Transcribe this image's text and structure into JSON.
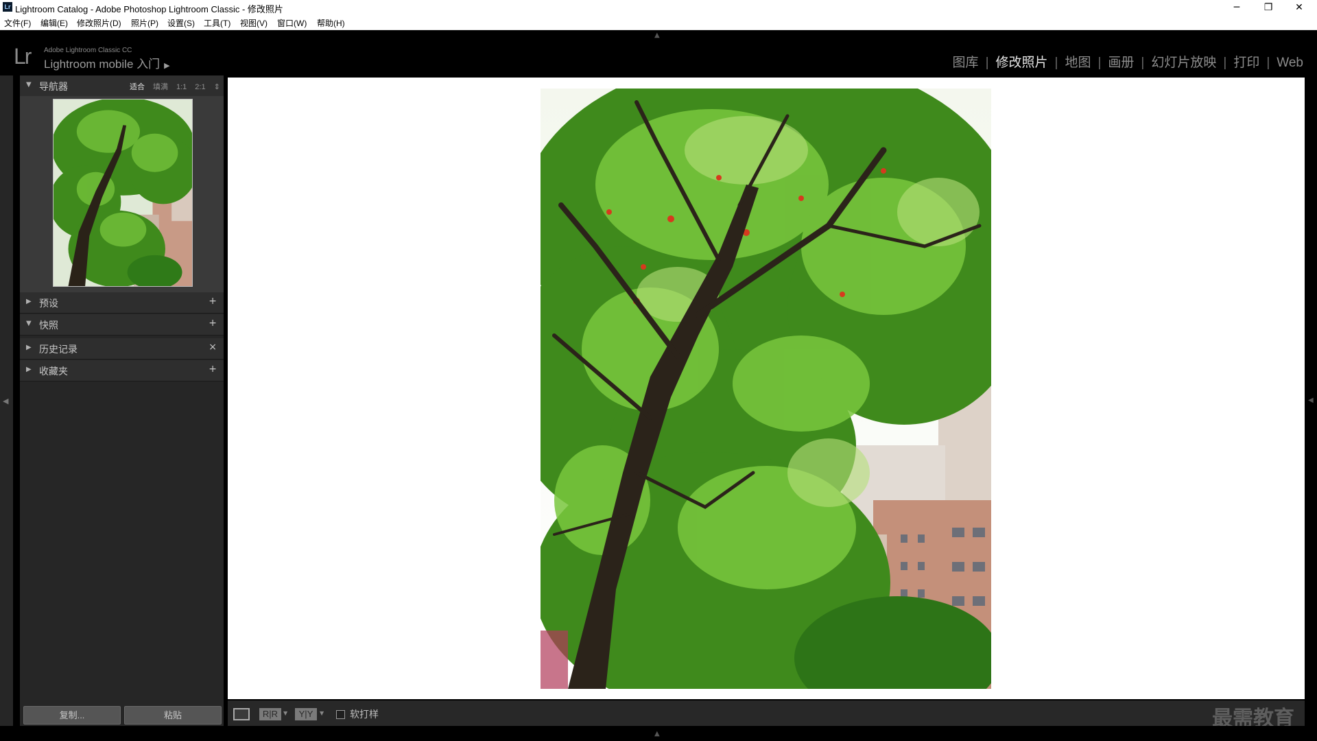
{
  "window": {
    "icon_text": "Lr",
    "title": "Lightroom Catalog - Adobe Photoshop Lightroom Classic - 修改照片",
    "controls": {
      "minimize": "─",
      "restore": "❐",
      "close": "✕"
    }
  },
  "menu": [
    "文件(F)",
    "编辑(E)",
    "修改照片(D)",
    "照片(P)",
    "设置(S)",
    "工具(T)",
    "视图(V)",
    "窗口(W)",
    "帮助(H)"
  ],
  "identity": {
    "logo": "Lr",
    "small": "Adobe Lightroom Classic CC",
    "main": "Lightroom mobile 入门",
    "arrow": "▶"
  },
  "modules": {
    "library": "图库",
    "develop": "修改照片",
    "map": "地图",
    "book": "画册",
    "slideshow": "幻灯片放映",
    "print": "打印",
    "web": "Web",
    "separator": "|"
  },
  "left_panel": {
    "navigator": {
      "title": "导航器",
      "zoom_options": [
        "适合",
        "填满",
        "1:1",
        "2:1"
      ],
      "zoom_more": "⇕"
    },
    "presets": {
      "title": "预设",
      "action": "+"
    },
    "snapshots": {
      "title": "快照",
      "action": "+"
    },
    "history": {
      "title": "历史记录",
      "action": "×"
    },
    "collections": {
      "title": "收藏夹",
      "action": "+"
    },
    "copy_button": "复制...",
    "paste_button": "粘贴"
  },
  "toolbar": {
    "before_after_lr": "R|R",
    "before_after_tb": "Y|Y",
    "soft_proofing_label": "软打样",
    "soft_proofing_checked": false
  },
  "watermark": "最需教育",
  "colors": {
    "panel_bg": "#262626",
    "header_bg": "#2e2e2e",
    "active_module": "#e6e6e6",
    "inactive_module": "#8d8d8d"
  }
}
